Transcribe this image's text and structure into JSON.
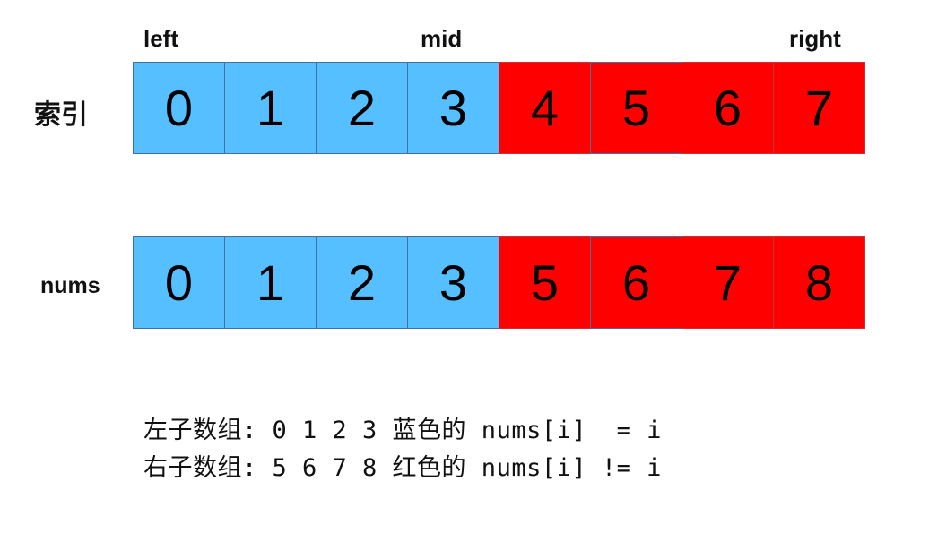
{
  "pointers": {
    "left": "left",
    "mid": "mid",
    "right": "right"
  },
  "rows": [
    {
      "label": "索引",
      "cells": [
        {
          "value": "0",
          "color": "blue"
        },
        {
          "value": "1",
          "color": "blue"
        },
        {
          "value": "2",
          "color": "blue"
        },
        {
          "value": "3",
          "color": "blue"
        },
        {
          "value": "4",
          "color": "red"
        },
        {
          "value": "5",
          "color": "red"
        },
        {
          "value": "6",
          "color": "red"
        },
        {
          "value": "7",
          "color": "red"
        }
      ]
    },
    {
      "label": "nums",
      "cells": [
        {
          "value": "0",
          "color": "blue"
        },
        {
          "value": "1",
          "color": "blue"
        },
        {
          "value": "2",
          "color": "blue"
        },
        {
          "value": "3",
          "color": "blue"
        },
        {
          "value": "5",
          "color": "red"
        },
        {
          "value": "6",
          "color": "red"
        },
        {
          "value": "7",
          "color": "red"
        },
        {
          "value": "8",
          "color": "red"
        }
      ]
    }
  ],
  "colors": {
    "blue": "#56bfff",
    "red": "#ff0000",
    "border": "#41719c"
  },
  "notes": [
    "左子数组: 0 1 2 3 蓝色的 nums[i]  = i",
    "右子数组: 5 6 7 8 红色的 nums[i] != i"
  ]
}
